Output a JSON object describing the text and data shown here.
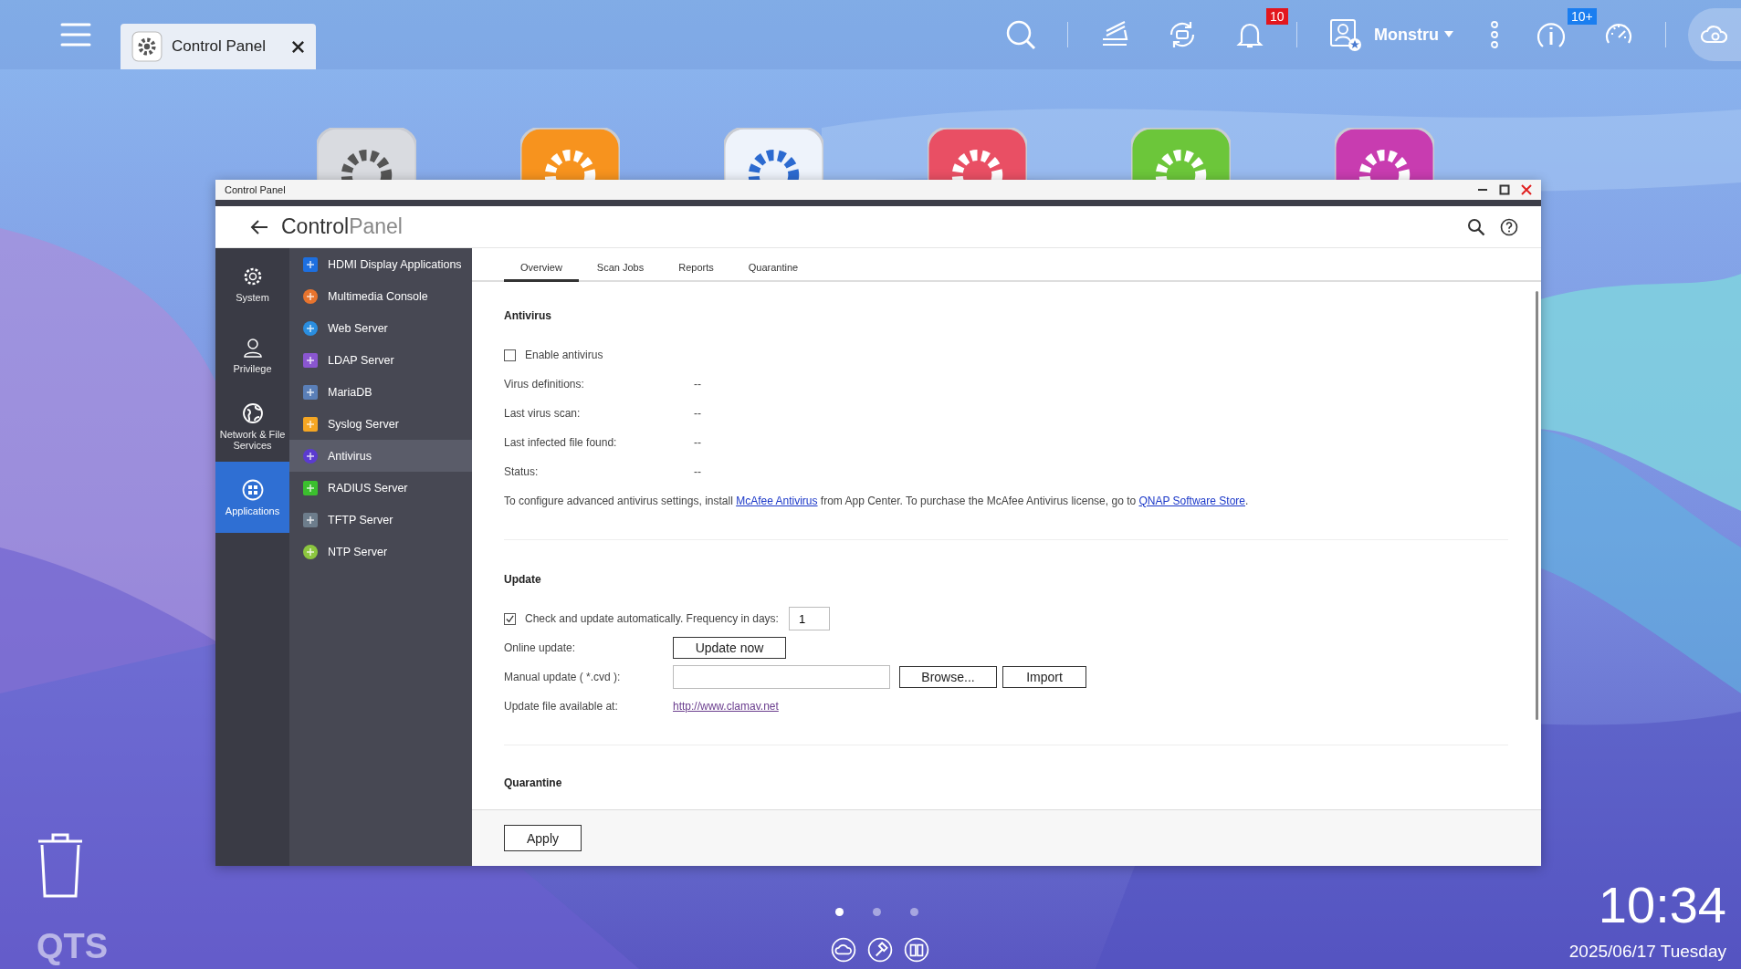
{
  "taskbar": {
    "tab": {
      "label": "Control Panel"
    },
    "notifications": "10",
    "user": "Monstru",
    "updates": "10+"
  },
  "window": {
    "title": "Control Panel",
    "app_title": [
      "Control",
      "Panel"
    ]
  },
  "categories": [
    {
      "label": "System",
      "selected": false
    },
    {
      "label": "Privilege",
      "selected": false
    },
    {
      "label": "Network & File Services",
      "selected": false
    },
    {
      "label": "Applications",
      "selected": true
    }
  ],
  "apps": [
    {
      "label": "HDMI Display Applications",
      "selected": false
    },
    {
      "label": "Multimedia Console",
      "selected": false
    },
    {
      "label": "Web Server",
      "selected": false
    },
    {
      "label": "LDAP Server",
      "selected": false
    },
    {
      "label": "MariaDB",
      "selected": false
    },
    {
      "label": "Syslog Server",
      "selected": false
    },
    {
      "label": "Antivirus",
      "selected": true
    },
    {
      "label": "RADIUS Server",
      "selected": false
    },
    {
      "label": "TFTP Server",
      "selected": false
    },
    {
      "label": "NTP Server",
      "selected": false
    }
  ],
  "tabs": [
    {
      "label": "Overview",
      "selected": true
    },
    {
      "label": "Scan Jobs",
      "selected": false
    },
    {
      "label": "Reports",
      "selected": false
    },
    {
      "label": "Quarantine",
      "selected": false
    }
  ],
  "antivirus": {
    "heading": "Antivirus",
    "enable": {
      "label": "Enable antivirus",
      "checked": false
    },
    "fields": [
      {
        "label": "Virus definitions:",
        "value": "--"
      },
      {
        "label": "Last virus scan:",
        "value": "--"
      },
      {
        "label": "Last infected file found:",
        "value": "--"
      },
      {
        "label": "Status:",
        "value": "--"
      }
    ],
    "note": [
      {
        "kind": "text",
        "text": "To configure advanced antivirus settings, install "
      },
      {
        "kind": "link",
        "text": "McAfee Antivirus"
      },
      {
        "kind": "text",
        "text": " from App Center. To purchase the McAfee Antivirus license, go to "
      },
      {
        "kind": "link",
        "text": "QNAP Software Store"
      },
      {
        "kind": "text",
        "text": "."
      }
    ]
  },
  "update": {
    "heading": "Update",
    "auto": {
      "label": "Check and update automatically. Frequency in days:",
      "checked": true,
      "value": "1"
    },
    "online": {
      "label": "Online update:",
      "button": "Update now"
    },
    "manual": {
      "label": "Manual update ( *.cvd ):",
      "browse": "Browse...",
      "import": "Import"
    },
    "source": {
      "label": "Update file available at:",
      "link": "http://www.clamav.net"
    }
  },
  "quarantine_heading": "Quarantine",
  "footer": {
    "apply": "Apply"
  },
  "desktop": {
    "brand": "QTS",
    "clock": "10:34",
    "date": "2025/06/17 Tuesday",
    "pages": [
      {
        "selected": true
      },
      {
        "selected": false
      },
      {
        "selected": false
      }
    ]
  }
}
